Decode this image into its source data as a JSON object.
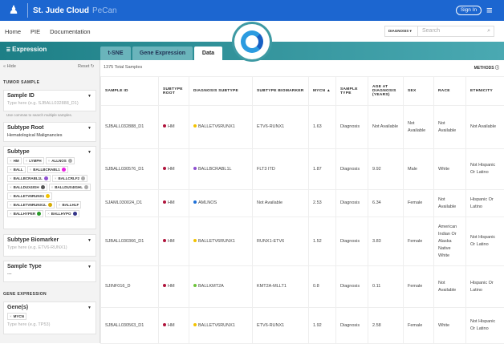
{
  "header": {
    "brand": "St. Jude Cloud",
    "product": "PeCan",
    "sign_in": "Sign In"
  },
  "nav": {
    "items": [
      "Home",
      "PIE",
      "Documentation"
    ],
    "search_scope": "DIAGNOSIS",
    "search_placeholder": "Search"
  },
  "toolbar": {
    "title": "Expression",
    "tabs": [
      "t-SNE",
      "Gene Expression",
      "Data"
    ],
    "active_tab": "Data"
  },
  "sidebar": {
    "hide": "« Hide",
    "reset": "Reset ↻",
    "tumor_section": "TUMOR SAMPLE",
    "gene_section": "GENE EXPRESSION",
    "sample_id": {
      "label": "Sample ID",
      "placeholder": "Type here (e.g. SJBALL032888_D1)",
      "hint": "Use commas to search multiple samples."
    },
    "subtype_root": {
      "label": "Subtype Root",
      "value": "Hematological Malignancies"
    },
    "subtype": {
      "label": "Subtype",
      "chips": [
        {
          "t": "HM",
          "c": ""
        },
        {
          "t": "LYMPH",
          "c": ""
        },
        {
          "t": "ALLNOS",
          "c": "#aaaaaa"
        },
        {
          "t": "BALL",
          "c": ""
        },
        {
          "t": "BALLBCRABL1",
          "c": "#e91ee0"
        },
        {
          "t": "BALLBCRABL1L",
          "c": "#8e4fd0"
        },
        {
          "t": "BALLCRLF2",
          "c": "#aaaaaa"
        },
        {
          "t": "BALLDUX4IGH",
          "c": "#555555"
        },
        {
          "t": "BALLDUX4IGHL",
          "c": "#aaaaaa"
        },
        {
          "t": "BALLETV6RUNX1",
          "c": "#f2c200"
        },
        {
          "t": "BALLETV6RUNX1L",
          "c": "#d4aa00"
        },
        {
          "t": "BALLHLF",
          "c": ""
        },
        {
          "t": "BALLHYPER",
          "c": "#2a9a2a"
        },
        {
          "t": "BALLHYPO",
          "c": "#333388"
        }
      ]
    },
    "subtype_biomarker": {
      "label": "Subtype Biomarker",
      "placeholder": "Type here (e.g. ETV6-RUNX1)"
    },
    "sample_type": {
      "label": "Sample Type",
      "value": "---"
    },
    "genes": {
      "label": "Gene(s)",
      "chip": "MYCN",
      "placeholder": "Type here (e.g. TP53)"
    }
  },
  "table": {
    "total": "1375 Total Samples",
    "methods": "METHODS ⓘ",
    "columns": [
      "SAMPLE ID",
      "SUBTYPE ROOT",
      "DIAGNOSIS SUBTYPE",
      "SUBTYPE BIOMARKER",
      "MYCN ▲",
      "SAMPLE TYPE",
      "AGE AT DIAGNOSIS (YEARS)",
      "SEX",
      "RACE",
      "ETHNICITY"
    ],
    "rows": [
      [
        "SJBALL032888_D1",
        "HM",
        "BALLETV6RUNX1",
        "ETV6-RUNX1",
        "1.63",
        "Diagnosis",
        "Not Available",
        "Not Available",
        "Not Available",
        "Not Available",
        "#f2c200"
      ],
      [
        "SJBALL030576_D1",
        "HM",
        "BALLBCRABL1L",
        "FLT3 ITD",
        "1.87",
        "Diagnosis",
        "9.92",
        "Male",
        "White",
        "Not Hispanic Or Latino",
        "#8e4fd0"
      ],
      [
        "SJAML030024_D1",
        "HM",
        "AMLNOS",
        "Not Available",
        "2.53",
        "Diagnosis",
        "6.34",
        "Female",
        "Not Available",
        "Hispanic Or Latino",
        "#1c6fd8"
      ],
      [
        "SJBALL030366_D1",
        "HM",
        "BALLETV6RUNX1",
        "RUNX1-ETV6",
        "1.52",
        "Diagnosis",
        "3.83",
        "Female",
        "American Indian Or Alaska Native White",
        "Not Hispanic Or Latino",
        "#f2c200"
      ],
      [
        "SJINF016_D",
        "HM",
        "BALLKMT2A",
        "KMT2A-MLLT1",
        "0.8",
        "Diagnosis",
        "0.11",
        "Female",
        "Not Available",
        "Hispanic Or Latino",
        "#6cc43a"
      ],
      [
        "SJBALL030563_D1",
        "HM",
        "BALLETV6RUNX1",
        "ETV6-RUNX1",
        "1.92",
        "Diagnosis",
        "2.58",
        "Female",
        "White",
        "Not Hispanic Or Latino",
        "#f2c200"
      ]
    ],
    "root_color": "#b0143c"
  }
}
